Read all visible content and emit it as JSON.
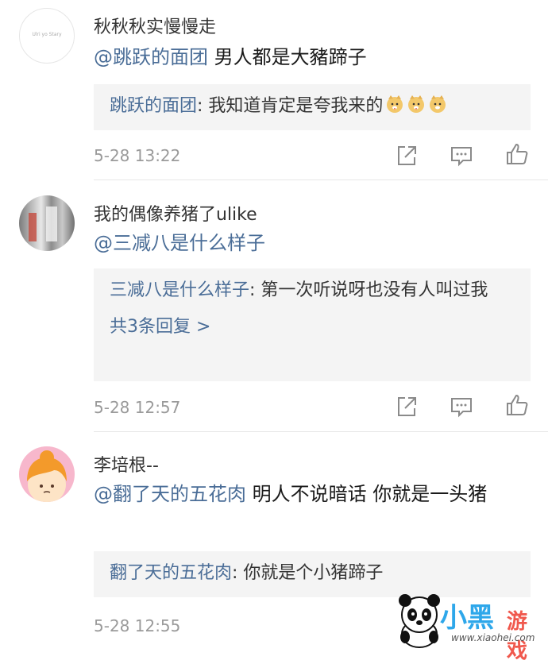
{
  "comments": [
    {
      "avatar_text": "Ulri yo Stary",
      "username": "秋秋秋实慢慢走",
      "mention": "@跳跃的面团",
      "text": " 男人都是大豬蹄子",
      "reply": {
        "name": "跳跃的面团",
        "text": ": 我知道肯定是夸我来的"
      },
      "time": "5-28 13:22"
    },
    {
      "username": "我的偶像养猪了ulike",
      "mention": "@三减八是什么样子",
      "text": "",
      "reply": {
        "name": "三减八是什么样子",
        "text": ": 第一次听说呀也没有人叫过我",
        "more": "共3条回复 >"
      },
      "time": "5-28 12:57"
    },
    {
      "username": "李培根--",
      "mention": "@翻了天的五花肉",
      "text": " 明人不说暗话 你就是一头猪",
      "reply": {
        "name": "翻了天的五花肉",
        "text": ": 你就是个小猪蹄子"
      },
      "time": "5-28 12:55"
    }
  ],
  "icons": [
    "share-icon",
    "comment-icon",
    "like-icon"
  ],
  "watermark": {
    "logo_text": "小黑",
    "logo_text2": "游戏",
    "url": "www.xiaohei.com"
  },
  "colors": {
    "link": "#4a6d97",
    "reply_bg": "#f4f4f4",
    "time": "#9a9a9a"
  }
}
